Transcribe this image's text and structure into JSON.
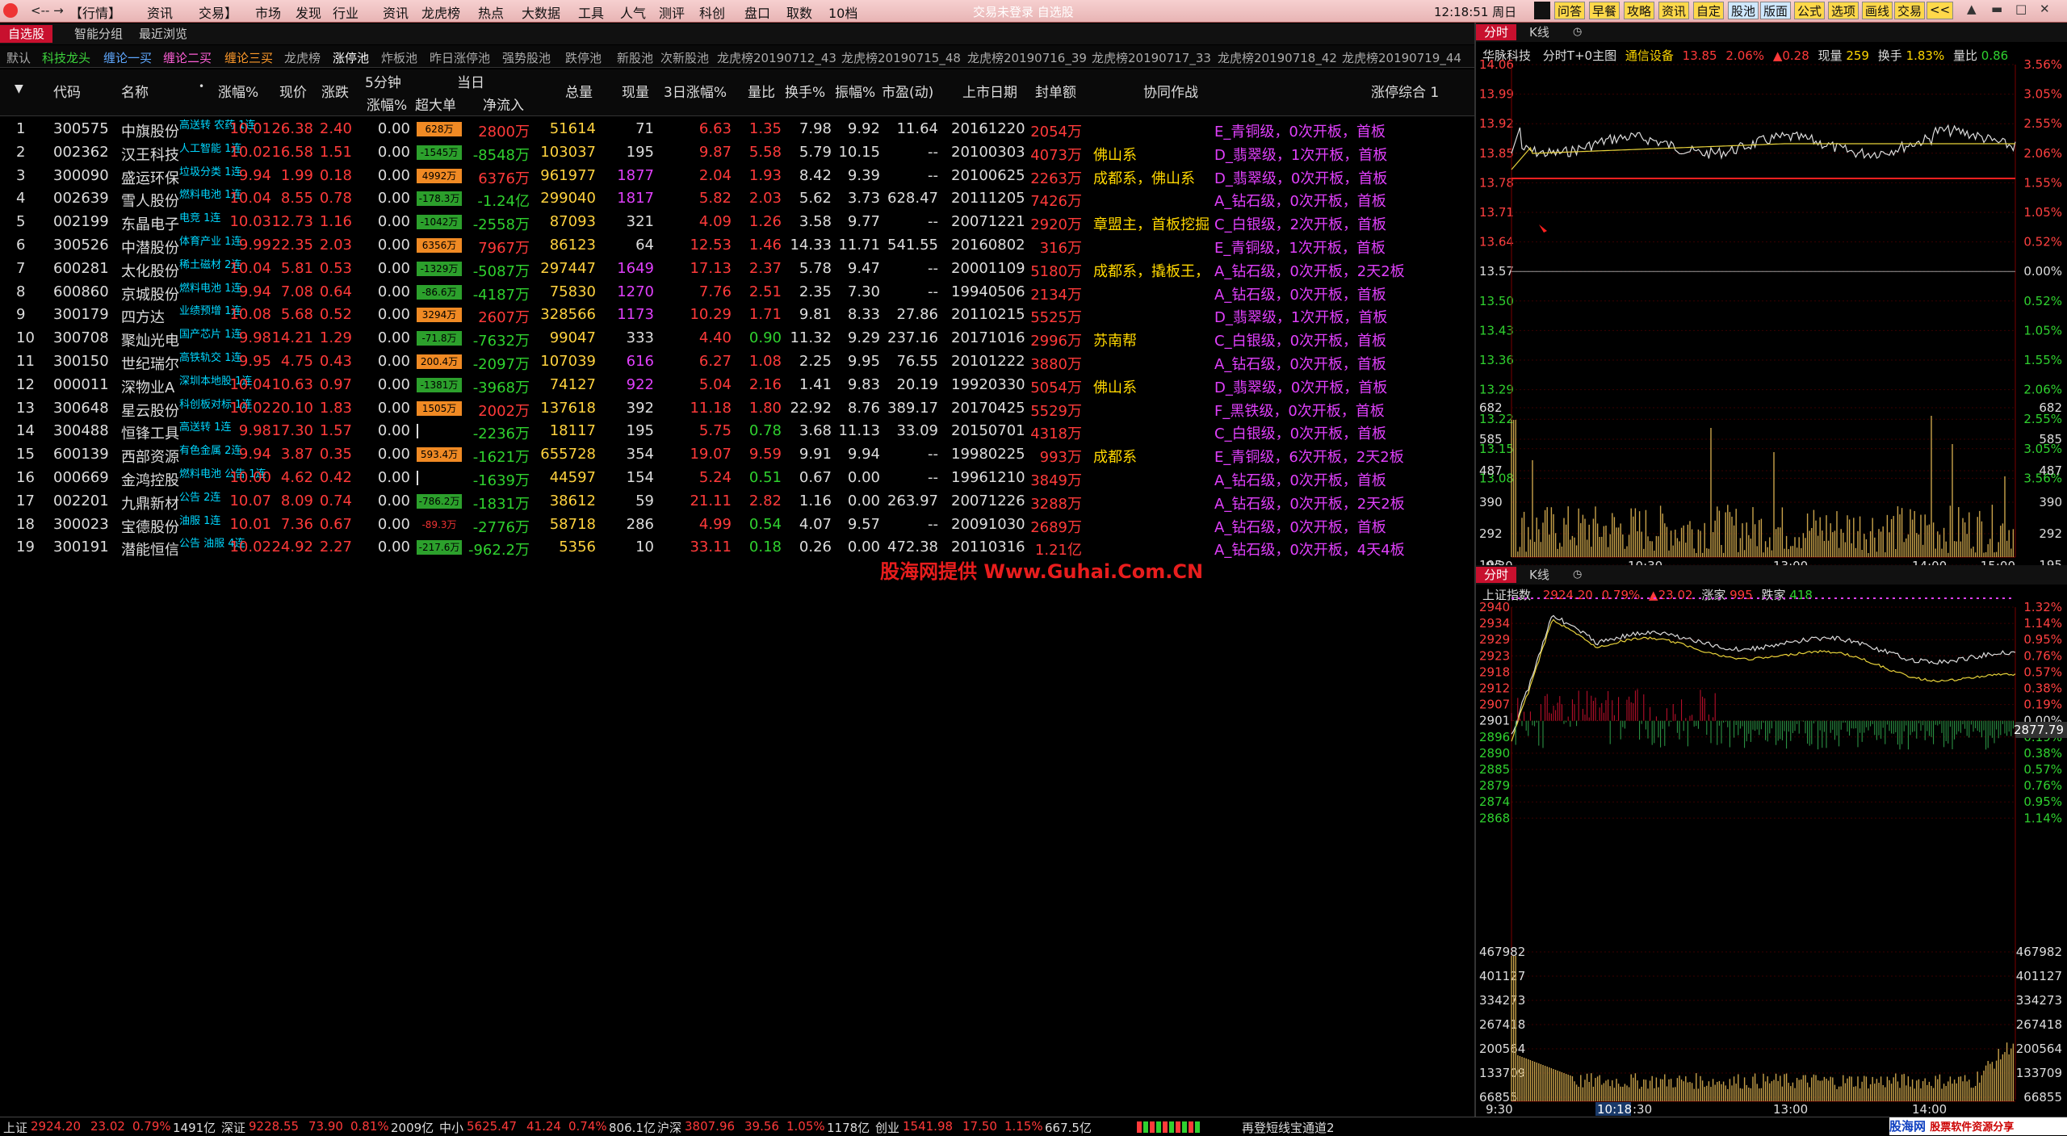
{
  "topbar": {
    "nav": "<-- →",
    "menu": [
      "【行情】",
      "资讯",
      "交易】",
      "市场",
      "发现",
      "行业",
      "资讯",
      "龙虎榜",
      "热点",
      "大数据",
      "工具",
      "人气",
      "测评",
      "科创",
      "盘口",
      "取数",
      "10档"
    ],
    "status_center": "交易未登录   自选股",
    "time": "12:18:51",
    "weekday": "周日",
    "right_buttons": [
      "问答",
      "早餐",
      "攻略",
      "资讯",
      "自定",
      "股池",
      "版面",
      "公式",
      "选项",
      "画线",
      "交易",
      "<<"
    ],
    "window_controls": [
      "▲",
      "▬",
      "□",
      "✕"
    ]
  },
  "tabs1": [
    {
      "label": "自选股",
      "active": true
    },
    {
      "label": "智能分组",
      "active": false
    },
    {
      "label": "最近浏览",
      "active": false
    }
  ],
  "tabs2": [
    {
      "label": "默认",
      "cls": ""
    },
    {
      "label": "科技龙头",
      "cls": "green"
    },
    {
      "label": "缠论一买",
      "cls": "blue"
    },
    {
      "label": "缠论二买",
      "cls": "pink"
    },
    {
      "label": "缠论三买",
      "cls": "orange"
    },
    {
      "label": "龙虎榜",
      "cls": ""
    },
    {
      "label": "涨停池",
      "cls": "white"
    },
    {
      "label": "炸板池",
      "cls": ""
    },
    {
      "label": "昨日涨停池",
      "cls": ""
    },
    {
      "label": "强势股池",
      "cls": ""
    },
    {
      "label": "跌停池",
      "cls": ""
    },
    {
      "label": "新股池",
      "cls": ""
    },
    {
      "label": "次新股池",
      "cls": ""
    },
    {
      "label": "龙虎榜20190712_43",
      "cls": ""
    },
    {
      "label": "龙虎榜20190715_48",
      "cls": ""
    },
    {
      "label": "龙虎榜20190716_39",
      "cls": ""
    },
    {
      "label": "龙虎榜20190717_33",
      "cls": ""
    },
    {
      "label": "龙虎榜20190718_42",
      "cls": ""
    },
    {
      "label": "龙虎榜20190719_44",
      "cls": ""
    }
  ],
  "table": {
    "headers": {
      "code": "代码",
      "name": "名称",
      "chg": "涨幅%",
      "price": "现价",
      "change": "涨跌",
      "min5": "5分钟",
      "min5_sub": "涨幅%",
      "today": "当日",
      "super": "超大单",
      "netin": "净流入",
      "vol": "总量",
      "cur": "现量",
      "chg3": "3日涨幅%",
      "vr": "量比",
      "turn": "换手%",
      "amp": "振幅%",
      "pe": "市盈(动)",
      "list": "上市日期",
      "seal": "封单额",
      "coop": "协同作战",
      "summary": "涨停综合 1"
    },
    "rows": [
      {
        "n": "1",
        "code": "300575",
        "name": "中旗股份",
        "tag": "高送转 农药 1连",
        "chg": "10.01",
        "price": "26.38",
        "change": "2.40",
        "m5": "0.00",
        "bar": "628万",
        "barc": "#f08a24",
        "net": "2800万",
        "netc": "r",
        "vol": "51614",
        "cur": "71",
        "curc": "w",
        "c3": "6.63",
        "vr": "1.35",
        "turn": "7.98",
        "amp": "9.92",
        "pe": "11.64",
        "list": "20161220",
        "seal": "2054万",
        "coop": "",
        "sum": "E_青铜级，0次开板，首板"
      },
      {
        "n": "2",
        "code": "002362",
        "name": "汉王科技",
        "tag": "人工智能 1连",
        "chg": "10.02",
        "price": "16.58",
        "change": "1.51",
        "m5": "0.00",
        "bar": "-1545万",
        "barc": "#2ca02c",
        "net": "-8548万",
        "netc": "g",
        "vol": "103037",
        "cur": "195",
        "curc": "w",
        "c3": "9.87",
        "vr": "5.58",
        "turn": "5.79",
        "amp": "10.15",
        "pe": "--",
        "list": "20100303",
        "seal": "4073万",
        "coop": "佛山系",
        "sum": "D_翡翠级，1次开板，首板"
      },
      {
        "n": "3",
        "code": "300090",
        "name": "盛运环保",
        "tag": "垃圾分类 1连",
        "chg": "9.94",
        "price": "1.99",
        "change": "0.18",
        "m5": "0.00",
        "bar": "4992万",
        "barc": "#f08a24",
        "net": "6376万",
        "netc": "r",
        "vol": "961977",
        "cur": "1877",
        "curc": "m",
        "c3": "2.04",
        "vr": "1.93",
        "turn": "8.42",
        "amp": "9.39",
        "pe": "--",
        "list": "20100625",
        "seal": "2263万",
        "coop": "成都系，佛山系",
        "sum": "D_翡翠级，0次开板，首板"
      },
      {
        "n": "4",
        "code": "002639",
        "name": "雪人股份",
        "tag": "燃料电池 1连",
        "chg": "10.04",
        "price": "8.55",
        "change": "0.78",
        "m5": "0.00",
        "bar": "-178.3万",
        "barc": "#2ca02c",
        "net": "-1.24亿",
        "netc": "g",
        "vol": "299040",
        "cur": "1817",
        "curc": "m",
        "c3": "5.82",
        "vr": "2.03",
        "turn": "5.62",
        "amp": "3.73",
        "pe": "628.47",
        "list": "20111205",
        "seal": "7426万",
        "coop": "",
        "sum": "A_钻石级，0次开板，首板"
      },
      {
        "n": "5",
        "code": "002199",
        "name": "东晶电子",
        "tag": "电竞 1连",
        "chg": "10.03",
        "price": "12.73",
        "change": "1.16",
        "m5": "0.00",
        "bar": "-1042万",
        "barc": "#2ca02c",
        "net": "-2558万",
        "netc": "g",
        "vol": "87093",
        "cur": "321",
        "curc": "w",
        "c3": "4.09",
        "vr": "1.26",
        "turn": "3.58",
        "amp": "9.77",
        "pe": "--",
        "list": "20071221",
        "seal": "2920万",
        "coop": "章盟主，首板挖掘",
        "sum": "C_白银级，2次开板，首板"
      },
      {
        "n": "6",
        "code": "300526",
        "name": "中潜股份",
        "tag": "体育产业 1连",
        "chg": "9.99",
        "price": "22.35",
        "change": "2.03",
        "m5": "0.00",
        "bar": "6356万",
        "barc": "#f08a24",
        "net": "7967万",
        "netc": "r",
        "vol": "86123",
        "cur": "64",
        "curc": "w",
        "c3": "12.53",
        "vr": "1.46",
        "turn": "14.33",
        "amp": "11.71",
        "pe": "541.55",
        "list": "20160802",
        "seal": "316万",
        "coop": "",
        "sum": "E_青铜级，1次开板，首板"
      },
      {
        "n": "7",
        "code": "600281",
        "name": "太化股份",
        "tag": "稀土磁材 2连",
        "chg": "10.04",
        "price": "5.81",
        "change": "0.53",
        "m5": "0.00",
        "bar": "-1329万",
        "barc": "#2ca02c",
        "net": "-5087万",
        "netc": "g",
        "vol": "297447",
        "cur": "1649",
        "curc": "m",
        "c3": "17.13",
        "vr": "2.37",
        "turn": "5.78",
        "amp": "9.47",
        "pe": "--",
        "list": "20001109",
        "seal": "5180万",
        "coop": "成都系，撬板王，",
        "sum": "A_钻石级，0次开板，2天2板"
      },
      {
        "n": "8",
        "code": "600860",
        "name": "京城股份",
        "tag": "燃料电池 1连",
        "chg": "9.94",
        "price": "7.08",
        "change": "0.64",
        "m5": "0.00",
        "bar": "-86.6万",
        "barc": "#2ca02c",
        "net": "-4187万",
        "netc": "g",
        "vol": "75830",
        "cur": "1270",
        "curc": "m",
        "c3": "7.76",
        "vr": "2.51",
        "turn": "2.35",
        "amp": "7.30",
        "pe": "--",
        "list": "19940506",
        "seal": "2134万",
        "coop": "",
        "sum": "A_钻石级，0次开板，首板"
      },
      {
        "n": "9",
        "code": "300179",
        "name": "四方达",
        "tag": "业绩预增 1连",
        "chg": "10.08",
        "price": "5.68",
        "change": "0.52",
        "m5": "0.00",
        "bar": "3294万",
        "barc": "#f08a24",
        "net": "2607万",
        "netc": "r",
        "vol": "328566",
        "cur": "1173",
        "curc": "m",
        "c3": "10.29",
        "vr": "1.71",
        "turn": "9.81",
        "amp": "8.33",
        "pe": "27.86",
        "list": "20110215",
        "seal": "5525万",
        "coop": "",
        "sum": "D_翡翠级，1次开板，首板"
      },
      {
        "n": "10",
        "code": "300708",
        "name": "聚灿光电",
        "tag": "国产芯片 1连",
        "chg": "9.98",
        "price": "14.21",
        "change": "1.29",
        "m5": "0.00",
        "bar": "-71.8万",
        "barc": "#2ca02c",
        "net": "-7632万",
        "netc": "g",
        "vol": "99047",
        "cur": "333",
        "curc": "w",
        "c3": "4.40",
        "vr": "0.90",
        "turn": "11.32",
        "amp": "9.29",
        "pe": "237.16",
        "list": "20171016",
        "seal": "2996万",
        "coop": "苏南帮",
        "sum": "C_白银级，0次开板，首板"
      },
      {
        "n": "11",
        "code": "300150",
        "name": "世纪瑞尔",
        "tag": "高铁轨交 1连",
        "chg": "9.95",
        "price": "4.75",
        "change": "0.43",
        "m5": "0.00",
        "bar": "200.4万",
        "barc": "#f08a24",
        "net": "-2097万",
        "netc": "g",
        "vol": "107039",
        "cur": "616",
        "curc": "m",
        "c3": "6.27",
        "vr": "1.08",
        "turn": "2.25",
        "amp": "9.95",
        "pe": "76.55",
        "list": "20101222",
        "seal": "3880万",
        "coop": "",
        "sum": "A_钻石级，0次开板，首板"
      },
      {
        "n": "12",
        "code": "000011",
        "name": "深物业A",
        "tag": "深圳本地股 1连",
        "chg": "10.04",
        "price": "10.63",
        "change": "0.97",
        "m5": "0.00",
        "bar": "-1381万",
        "barc": "#2ca02c",
        "net": "-3968万",
        "netc": "g",
        "vol": "74127",
        "cur": "922",
        "curc": "m",
        "c3": "5.04",
        "vr": "2.16",
        "turn": "1.41",
        "amp": "9.83",
        "pe": "20.19",
        "list": "19920330",
        "seal": "5054万",
        "coop": "佛山系",
        "sum": "D_翡翠级，0次开板，首板"
      },
      {
        "n": "13",
        "code": "300648",
        "name": "星云股份",
        "tag": "科创板对标 1连",
        "chg": "10.02",
        "price": "20.10",
        "change": "1.83",
        "m5": "0.00",
        "bar": "1505万",
        "barc": "#f08a24",
        "net": "2002万",
        "netc": "r",
        "vol": "137618",
        "cur": "392",
        "curc": "w",
        "c3": "11.18",
        "vr": "1.80",
        "turn": "22.92",
        "amp": "8.76",
        "pe": "389.17",
        "list": "20170425",
        "seal": "5529万",
        "coop": "",
        "sum": "F_黑铁级，0次开板，首板"
      },
      {
        "n": "14",
        "code": "300488",
        "name": "恒锋工具",
        "tag": "高送转 1连",
        "chg": "9.98",
        "price": "17.30",
        "change": "1.57",
        "m5": "0.00",
        "bar": "",
        "barc": "#000",
        "net": "-2236万",
        "netc": "g",
        "vol": "18117",
        "cur": "195",
        "curc": "w",
        "c3": "5.75",
        "vr": "0.78",
        "turn": "3.68",
        "amp": "11.13",
        "pe": "33.09",
        "list": "20150701",
        "seal": "4318万",
        "coop": "",
        "sum": "C_白银级，0次开板，首板"
      },
      {
        "n": "15",
        "code": "600139",
        "name": "西部资源",
        "tag": "有色金属 2连",
        "chg": "9.94",
        "price": "3.87",
        "change": "0.35",
        "m5": "0.00",
        "bar": "593.4万",
        "barc": "#f08a24",
        "net": "-1621万",
        "netc": "g",
        "vol": "655728",
        "cur": "354",
        "curc": "w",
        "c3": "19.07",
        "vr": "9.59",
        "turn": "9.91",
        "amp": "9.94",
        "pe": "--",
        "list": "19980225",
        "seal": "993万",
        "coop": "成都系",
        "sum": "E_青铜级，6次开板，2天2板"
      },
      {
        "n": "16",
        "code": "000669",
        "name": "金鸿控股",
        "tag": "燃料电池 公告 1连",
        "chg": "10.00",
        "price": "4.62",
        "change": "0.42",
        "m5": "0.00",
        "bar": "",
        "barc": "#000",
        "net": "-1639万",
        "netc": "g",
        "vol": "44597",
        "cur": "154",
        "curc": "w",
        "c3": "5.24",
        "vr": "0.51",
        "turn": "0.67",
        "amp": "0.00",
        "pe": "--",
        "list": "19961210",
        "seal": "3849万",
        "coop": "",
        "sum": "A_钻石级，0次开板，首板"
      },
      {
        "n": "17",
        "code": "002201",
        "name": "九鼎新材",
        "tag": "公告 2连",
        "chg": "10.07",
        "price": "8.09",
        "change": "0.74",
        "m5": "0.00",
        "bar": "-786.2万",
        "barc": "#2ca02c",
        "net": "-1831万",
        "netc": "g",
        "vol": "38612",
        "cur": "59",
        "curc": "w",
        "c3": "21.11",
        "vr": "2.82",
        "turn": "1.16",
        "amp": "0.00",
        "pe": "263.97",
        "list": "20071226",
        "seal": "3288万",
        "coop": "",
        "sum": "A_钻石级，0次开板，2天2板"
      },
      {
        "n": "18",
        "code": "300023",
        "name": "宝德股份",
        "tag": "油服 1连",
        "chg": "10.01",
        "price": "7.36",
        "change": "0.67",
        "m5": "0.00",
        "bar": "-89.3万",
        "barc": "#000",
        "net": "-2776万",
        "netc": "g",
        "vol": "58718",
        "cur": "286",
        "curc": "w",
        "c3": "4.99",
        "vr": "0.54",
        "turn": "4.07",
        "amp": "9.57",
        "pe": "--",
        "list": "20091030",
        "seal": "2689万",
        "coop": "",
        "sum": "A_钻石级，0次开板，首板"
      },
      {
        "n": "19",
        "code": "300191",
        "name": "潜能恒信",
        "tag": "公告 油服 4连",
        "chg": "10.02",
        "price": "24.92",
        "change": "2.27",
        "m5": "0.00",
        "bar": "-217.6万",
        "barc": "#2ca02c",
        "net": "-962.2万",
        "netc": "g",
        "vol": "5356",
        "cur": "10",
        "curc": "w",
        "c3": "33.11",
        "vr": "0.18",
        "turn": "0.26",
        "amp": "0.00",
        "pe": "472.38",
        "list": "20110316",
        "seal": "1.21亿",
        "coop": "",
        "sum": "A_钻石级，0次开板，4天4板"
      }
    ]
  },
  "watermark": "股海网提供 Www.Guhai.Com.CN",
  "panel_top": {
    "tabs": [
      "分时",
      "K线"
    ],
    "stock": "华脉科技",
    "mode": "分时T+0主图",
    "sector": "通信设备",
    "price": "13.85",
    "pct": "2.06%",
    "delta": "▲0.28",
    "vol_label": "现量",
    "vol": "259",
    "turn_label": "换手",
    "turn": "1.83%",
    "vr_label": "量比",
    "vr": "0.86",
    "price_axis": [
      "14.06",
      "13.99",
      "13.92",
      "13.85",
      "13.78",
      "13.71",
      "13.64",
      "13.57",
      "13.50",
      "13.43",
      "13.36",
      "13.29",
      "13.22",
      "13.15",
      "13.08"
    ],
    "pct_axis": [
      "3.56%",
      "3.05%",
      "2.55%",
      "2.06%",
      "1.55%",
      "1.05%",
      "0.52%",
      "0.00%",
      "0.52%",
      "1.05%",
      "1.55%",
      "2.06%",
      "2.55%",
      "3.05%",
      "3.56%"
    ],
    "vol_axis": [
      "682",
      "585",
      "487",
      "390",
      "292",
      "195",
      "97"
    ],
    "time_axis": [
      "9:30",
      "10:30",
      "13:00",
      "14:00",
      "15:00"
    ]
  },
  "panel_bottom": {
    "tabs": [
      "分时",
      "K线"
    ],
    "index": "上证指数",
    "price": "2924.20",
    "pct": "0.79%",
    "delta": "▲23.02",
    "up_label": "涨家",
    "up": "995",
    "down_label": "跌家",
    "down": "418",
    "price_axis": [
      "2940",
      "2934",
      "2929",
      "2923",
      "2918",
      "2912",
      "2907",
      "2901",
      "2896",
      "2890",
      "2885",
      "2879",
      "2874",
      "2868"
    ],
    "pct_axis": [
      "1.32%",
      "1.14%",
      "0.95%",
      "0.76%",
      "0.57%",
      "0.38%",
      "0.19%",
      "0.00%",
      "0.19%",
      "0.38%",
      "0.57%",
      "0.76%",
      "0.95%",
      "1.14%"
    ],
    "cursor_value": "2877.79",
    "vol_axis": [
      "467982",
      "401127",
      "334273",
      "267418",
      "200564",
      "133709",
      "66855"
    ],
    "time_axis": [
      "9:30",
      "10:18",
      "13:00",
      "14:00",
      "15:00"
    ],
    "time_label_partial": ":30"
  },
  "statusbar": {
    "items": [
      {
        "t": "上证",
        "c": "w"
      },
      {
        "t": "2924.20",
        "c": "r"
      },
      {
        "t": "23.02",
        "c": "r"
      },
      {
        "t": "0.79%",
        "c": "r"
      },
      {
        "t": "1491亿",
        "c": "w"
      },
      {
        "t": "深证",
        "c": "w"
      },
      {
        "t": "9228.55",
        "c": "r"
      },
      {
        "t": "73.90",
        "c": "r"
      },
      {
        "t": "0.81%",
        "c": "r"
      },
      {
        "t": "2009亿",
        "c": "w"
      },
      {
        "t": "中小",
        "c": "w"
      },
      {
        "t": "5625.47",
        "c": "r"
      },
      {
        "t": "41.24",
        "c": "r"
      },
      {
        "t": "0.74%",
        "c": "r"
      },
      {
        "t": "806.1亿",
        "c": "w"
      },
      {
        "t": "沪深",
        "c": "w"
      },
      {
        "t": "3807.96",
        "c": "r"
      },
      {
        "t": "39.56",
        "c": "r"
      },
      {
        "t": "1.05%",
        "c": "r"
      },
      {
        "t": "1178亿",
        "c": "w"
      },
      {
        "t": "创业",
        "c": "w"
      },
      {
        "t": "1541.98",
        "c": "r"
      },
      {
        "t": "17.50",
        "c": "r"
      },
      {
        "t": "1.15%",
        "c": "r"
      },
      {
        "t": "667.5亿",
        "c": "w"
      }
    ],
    "ticker": "再登短线宝通道2",
    "brand": "股海网",
    "brand_sub": "股票软件资源分享",
    "brand_url": "www.Guhai.Com.CN"
  },
  "colors": {
    "up": "#ff3a3a",
    "down": "#2fd12f",
    "accent": "#c8102e",
    "price_line": "#ffffff",
    "avg_line": "#e8d23a"
  }
}
